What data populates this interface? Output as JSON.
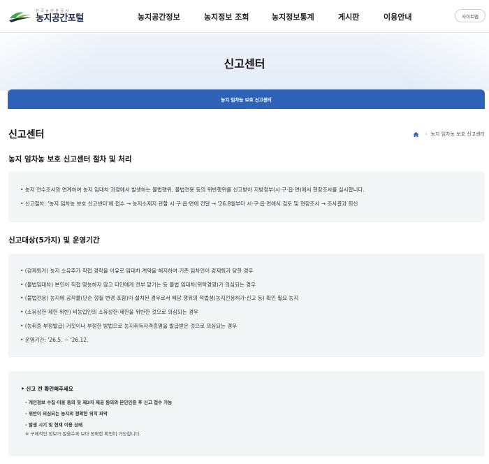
{
  "header": {
    "logo_small": "한국농어촌공사",
    "logo_main": "농지공간포털",
    "nav": [
      "농지공간정보",
      "농지정보 조회",
      "농지정보통계",
      "게시판",
      "이용안내"
    ],
    "sitemap_label": "사이트맵"
  },
  "hero": {
    "title": "신고센터",
    "tab_label": "농지 임차농 보호 신고센터"
  },
  "page": {
    "title": "신고센터",
    "breadcrumb": [
      "농지 임차농 보호 신고센터"
    ]
  },
  "section1": {
    "title": "농지 임차농 보호 신고센터 절차 및 처리",
    "items": [
      "• 농지 전수조사와 연계하여 농지 임대차 과정에서 발생하는 불법행위, 불법전용 등의 위반행위를 신고받아 지방정부(시·구·읍·면)에서 현장조사를 실시합니다.",
      "• 신고절차: '농지 임차농 보호 신고센터'에 접수 → 농지소재지 관할 시·구·읍·면에 전달 → '26.8월부터 시·구·읍·면에서 검토 및 현장조사 → 조사결과 회신"
    ]
  },
  "section2": {
    "title": "신고대상(5가지) 및 운영기간",
    "items": [
      "• (강제퇴거) 농지 소유주가 직접 경작을 이유로 임대차 계약을 해지하여 기존 임차인이 강제퇴거 당한 경우",
      "• (불법임대차) 본인이 직접 영농하지 않고 타인에게 전부 맡기는 등 불법 임대차(위탁경영)가 의심되는 경우",
      "• (불법전용) 농지에 공작물(단순 형질 변경 포함)이 설치된 경우로서 해당 행위의 적법성(농지전용허가·신고 등) 확인 필요 농지",
      "• (소유상한·제한 위반) 비농업인의 소유상한·제한을 위반한 것으로 의심되는 경우",
      "• (농취증 부정발급) 거짓이나 부정한 방법으로 농지취득자격증명을 발급받은 것으로 의심되는 경우",
      "• 운영기간: '26.5. ~ '26.12."
    ]
  },
  "notice": {
    "title": "• 신고 전 확인해주세요",
    "items": [
      "- 개인정보 수집·이용 동의 및 제3자 제공 동의와 본인인증 후 신고 접수 가능",
      "- 위반이 의심되는 농지의 정확한 위치 파악",
      "- 발생 시기 및 현재 이용 상태"
    ],
    "note": "※ 구체적인 정보가 많을수록 보다 정확한 확인이 가능합니다."
  },
  "colors": {
    "accent": "#2f63b8",
    "logo_green": "#3fa34d",
    "logo_navy": "#1d2b44",
    "box_bg": "#f4f5f7"
  }
}
